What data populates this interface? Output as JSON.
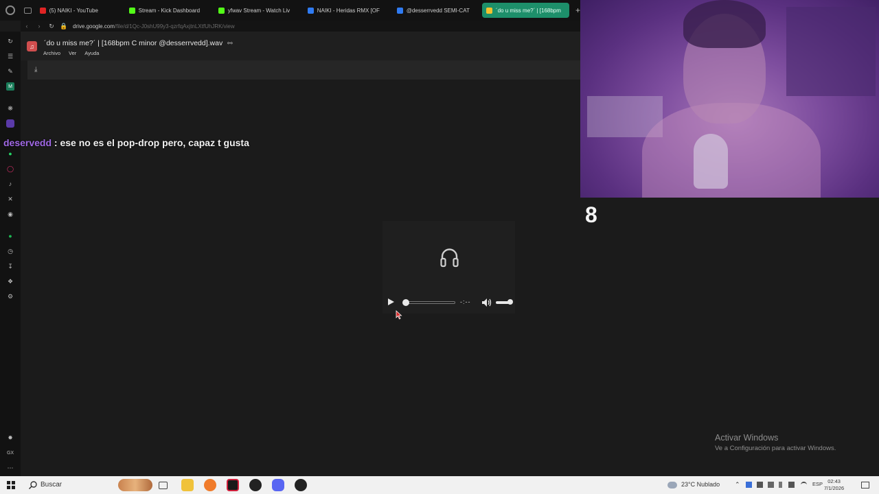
{
  "browser": {
    "tabs": [
      {
        "label": "(5) NAIKI - YouTube",
        "color": "#e02424"
      },
      {
        "label": "Stream - Kick Dashboard",
        "color": "#53fc18"
      },
      {
        "label": "yfwav Stream - Watch Liv",
        "color": "#53fc18"
      },
      {
        "label": "NAIKI - Heridas RMX [OF",
        "color": "#2f7bf2"
      },
      {
        "label": "@desserrvedd SEMI-CAT",
        "color": "#2f7bf2"
      },
      {
        "label": "´do u miss me?´ | [168bpm",
        "color": "#2f7bf2"
      }
    ],
    "new_tab_label": "+",
    "url_host": "drive.google.com",
    "url_path": "/file/d/1Qc-J0shU99y3-qzrfqAxjtnLXtfUhJRK/view"
  },
  "viewer": {
    "file_title": "´do u miss me?´ | [168bpm C minor @desserrvedd].wav",
    "menu": [
      "Archivo",
      "Ver",
      "Ayuda"
    ]
  },
  "chat": {
    "username": "deservedd",
    "message": " : ese no es el pop-drop pero, capaz t gusta"
  },
  "player": {
    "progress": 0.0,
    "volume": 1.0,
    "time_separator": "-:--"
  },
  "overlay": {
    "counter": "8"
  },
  "watermark": {
    "title": "Activar Windows",
    "subtitle": "Ve a Configuración para activar Windows."
  },
  "taskbar": {
    "search_label": "Buscar",
    "weather": "23°C  Nublado",
    "language": "ESP",
    "time": "02:43",
    "date": "7/1/2026"
  }
}
